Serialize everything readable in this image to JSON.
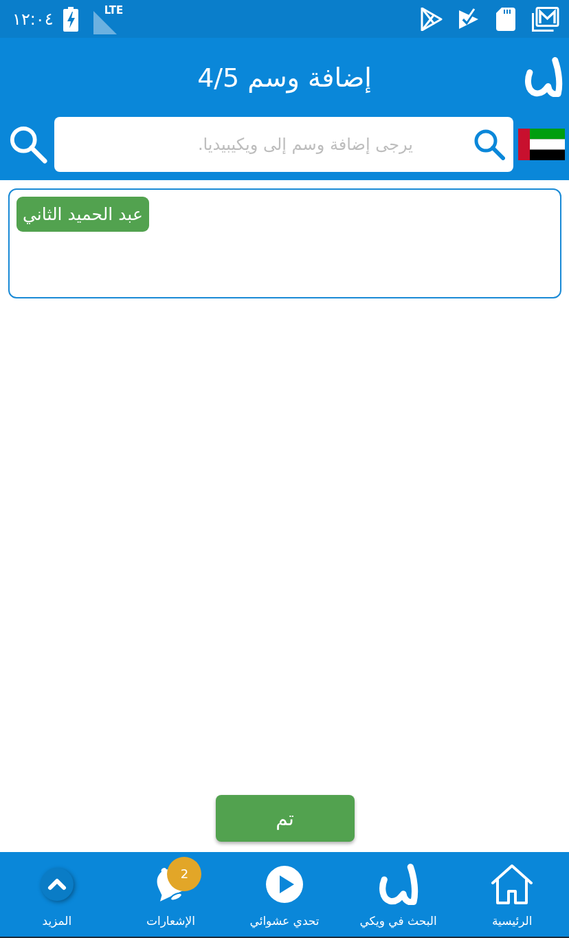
{
  "status_bar": {
    "time": "١٢:٠٤",
    "network": "LTE"
  },
  "header": {
    "title": "إضافة وسم 4/5"
  },
  "search": {
    "placeholder": "يرجى إضافة وسم إلى ويكيبيديا."
  },
  "tags": [
    {
      "label": "عبد الحميد الثاني"
    }
  ],
  "done_button": "تم",
  "bottom_nav": [
    {
      "kind": "home",
      "label": "الرئيسية"
    },
    {
      "kind": "wiki",
      "label": "البحث في ويكي"
    },
    {
      "kind": "random",
      "label": "تحدي عشوائي"
    },
    {
      "kind": "notifications",
      "label": "الإشعارات",
      "badge": "2"
    },
    {
      "kind": "more",
      "label": "المزيد"
    }
  ]
}
